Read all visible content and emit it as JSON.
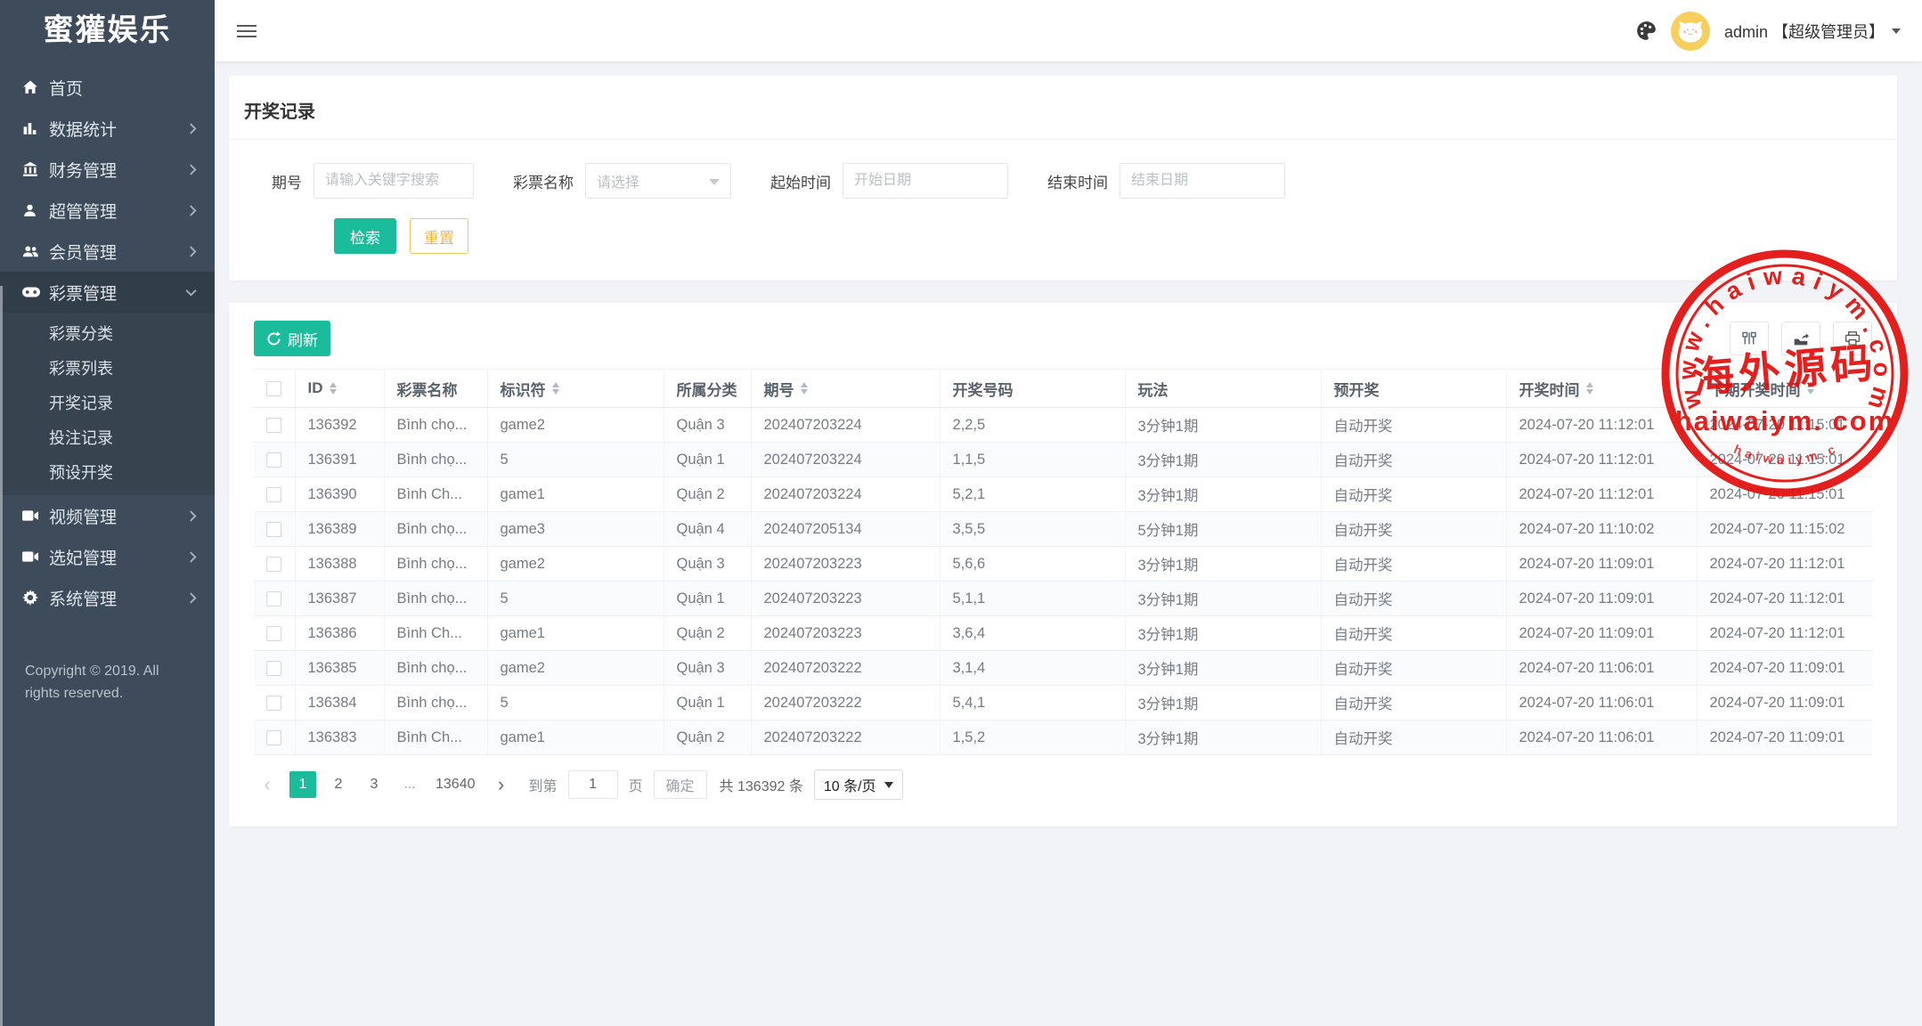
{
  "app": {
    "logo_text": "蜜獾娱乐"
  },
  "topbar": {
    "admin_label": "admin 【超级管理员】"
  },
  "sidebar": {
    "items": [
      {
        "name": "home",
        "label": "首页",
        "icon": "home-icon"
      },
      {
        "name": "data-stats",
        "label": "数据统计",
        "icon": "chart-icon",
        "chevron": "right"
      },
      {
        "name": "finance-mgmt",
        "label": "财务管理",
        "icon": "bank-icon",
        "chevron": "right"
      },
      {
        "name": "admin-mgmt",
        "label": "超管管理",
        "icon": "user-icon",
        "chevron": "right"
      },
      {
        "name": "member-mgmt",
        "label": "会员管理",
        "icon": "users-icon",
        "chevron": "right"
      },
      {
        "name": "lottery-mgmt",
        "label": "彩票管理",
        "icon": "gamepad-icon",
        "chevron": "down",
        "active": true,
        "children": [
          {
            "name": "lottery-category",
            "label": "彩票分类"
          },
          {
            "name": "lottery-list",
            "label": "彩票列表"
          },
          {
            "name": "draw-records",
            "label": "开奖记录"
          },
          {
            "name": "bet-records",
            "label": "投注记录"
          },
          {
            "name": "preset-draw",
            "label": "预设开奖"
          }
        ]
      },
      {
        "name": "video-mgmt",
        "label": "视频管理",
        "icon": "video-icon",
        "chevron": "right"
      },
      {
        "name": "concubine-mgmt",
        "label": "选妃管理",
        "icon": "video-icon",
        "chevron": "right"
      },
      {
        "name": "system-mgmt",
        "label": "系统管理",
        "icon": "gear-icon",
        "chevron": "right"
      }
    ],
    "copyright": "Copyright © 2019. All rights reserved."
  },
  "page": {
    "title": "开奖记录"
  },
  "search": {
    "fields": [
      {
        "name": "issue-number",
        "label": "期号",
        "placeholder": "请输入关键字搜索",
        "type": "text"
      },
      {
        "name": "lottery-name",
        "label": "彩票名称",
        "placeholder": "请选择",
        "type": "select"
      },
      {
        "name": "start-time",
        "label": "起始时间",
        "placeholder": "开始日期",
        "type": "text"
      },
      {
        "name": "end-time",
        "label": "结束时间",
        "placeholder": "结束日期",
        "type": "text"
      }
    ],
    "search_button": "检索",
    "reset_button": "重置"
  },
  "table": {
    "refresh_button": "刷新",
    "columns": [
      {
        "label": "ID",
        "sortable": true
      },
      {
        "label": "彩票名称",
        "sortable": false
      },
      {
        "label": "标识符",
        "sortable": true
      },
      {
        "label": "所属分类",
        "sortable": false
      },
      {
        "label": "期号",
        "sortable": true
      },
      {
        "label": "开奖号码",
        "sortable": false
      },
      {
        "label": "玩法",
        "sortable": false
      },
      {
        "label": "预开奖",
        "sortable": false
      },
      {
        "label": "开奖时间",
        "sortable": true
      },
      {
        "label": "下期开奖时间",
        "sortable": true
      }
    ],
    "rows": [
      [
        "136392",
        "Bình chọ...",
        "game2",
        "Quận 3",
        "202407203224",
        "2,2,5",
        "3分钟1期",
        "自动开奖",
        "2024-07-20 11:12:01",
        "2024-07-20 11:15:01"
      ],
      [
        "136391",
        "Bình chọ...",
        "5",
        "Quận 1",
        "202407203224",
        "1,1,5",
        "3分钟1期",
        "自动开奖",
        "2024-07-20 11:12:01",
        "2024-07-20 11:15:01"
      ],
      [
        "136390",
        "Bình Ch...",
        "game1",
        "Quận 2",
        "202407203224",
        "5,2,1",
        "3分钟1期",
        "自动开奖",
        "2024-07-20 11:12:01",
        "2024-07-20 11:15:01"
      ],
      [
        "136389",
        "Bình chọ...",
        "game3",
        "Quận 4",
        "202407205134",
        "3,5,5",
        "5分钟1期",
        "自动开奖",
        "2024-07-20 11:10:02",
        "2024-07-20 11:15:02"
      ],
      [
        "136388",
        "Bình chọ...",
        "game2",
        "Quận 3",
        "202407203223",
        "5,6,6",
        "3分钟1期",
        "自动开奖",
        "2024-07-20 11:09:01",
        "2024-07-20 11:12:01"
      ],
      [
        "136387",
        "Bình chọ...",
        "5",
        "Quận 1",
        "202407203223",
        "5,1,1",
        "3分钟1期",
        "自动开奖",
        "2024-07-20 11:09:01",
        "2024-07-20 11:12:01"
      ],
      [
        "136386",
        "Bình Ch...",
        "game1",
        "Quận 2",
        "202407203223",
        "3,6,4",
        "3分钟1期",
        "自动开奖",
        "2024-07-20 11:09:01",
        "2024-07-20 11:12:01"
      ],
      [
        "136385",
        "Bình chọ...",
        "game2",
        "Quận 3",
        "202407203222",
        "3,1,4",
        "3分钟1期",
        "自动开奖",
        "2024-07-20 11:06:01",
        "2024-07-20 11:09:01"
      ],
      [
        "136384",
        "Bình chọ...",
        "5",
        "Quận 1",
        "202407203222",
        "5,4,1",
        "3分钟1期",
        "自动开奖",
        "2024-07-20 11:06:01",
        "2024-07-20 11:09:01"
      ],
      [
        "136383",
        "Bình Ch...",
        "game1",
        "Quận 2",
        "202407203222",
        "1,5,2",
        "3分钟1期",
        "自动开奖",
        "2024-07-20 11:06:01",
        "2024-07-20 11:09:01"
      ]
    ]
  },
  "pagination": {
    "pages": [
      "1",
      "2",
      "3",
      "...",
      "13640"
    ],
    "active_page": "1",
    "jump_prefix": "到第",
    "jump_value": "1",
    "jump_suffix": "页",
    "confirm_button": "确定",
    "total_text": "共 136392 条",
    "page_size": "10 条/页"
  },
  "watermark": {
    "ring_text": "www.haiwaiym.com",
    "center_text": "海外源码",
    "sub_text": "haiwaiym. com",
    "arc_text": "haiwaiym.com",
    "color": "#e3100e"
  },
  "colors": {
    "accent": "#1abc9c",
    "sidebar": "#3e4b5a",
    "reset_border": "#f5c65d",
    "reset_text": "#f2b63c"
  }
}
